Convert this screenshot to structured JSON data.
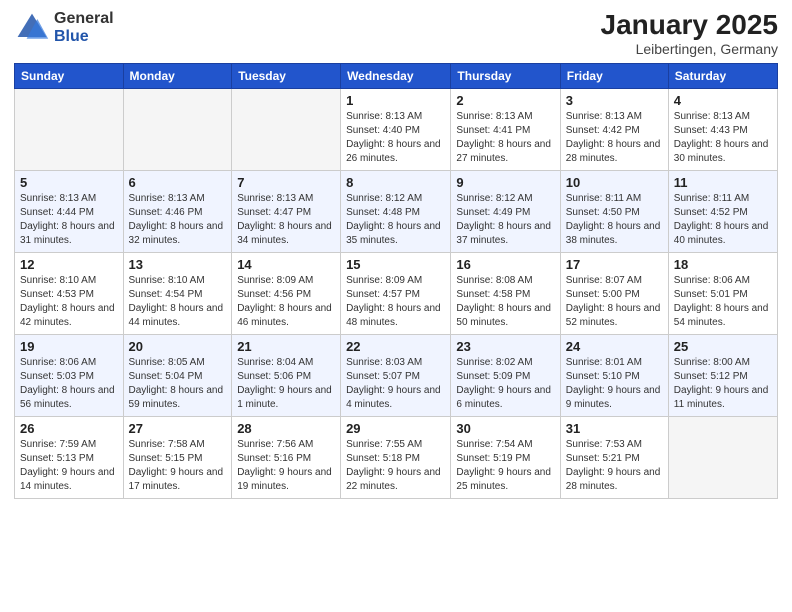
{
  "logo": {
    "general": "General",
    "blue": "Blue"
  },
  "header": {
    "month": "January 2025",
    "location": "Leibertingen, Germany"
  },
  "weekdays": [
    "Sunday",
    "Monday",
    "Tuesday",
    "Wednesday",
    "Thursday",
    "Friday",
    "Saturday"
  ],
  "weeks": [
    [
      {
        "day": "",
        "info": ""
      },
      {
        "day": "",
        "info": ""
      },
      {
        "day": "",
        "info": ""
      },
      {
        "day": "1",
        "info": "Sunrise: 8:13 AM\nSunset: 4:40 PM\nDaylight: 8 hours and 26 minutes."
      },
      {
        "day": "2",
        "info": "Sunrise: 8:13 AM\nSunset: 4:41 PM\nDaylight: 8 hours and 27 minutes."
      },
      {
        "day": "3",
        "info": "Sunrise: 8:13 AM\nSunset: 4:42 PM\nDaylight: 8 hours and 28 minutes."
      },
      {
        "day": "4",
        "info": "Sunrise: 8:13 AM\nSunset: 4:43 PM\nDaylight: 8 hours and 30 minutes."
      }
    ],
    [
      {
        "day": "5",
        "info": "Sunrise: 8:13 AM\nSunset: 4:44 PM\nDaylight: 8 hours and 31 minutes."
      },
      {
        "day": "6",
        "info": "Sunrise: 8:13 AM\nSunset: 4:46 PM\nDaylight: 8 hours and 32 minutes."
      },
      {
        "day": "7",
        "info": "Sunrise: 8:13 AM\nSunset: 4:47 PM\nDaylight: 8 hours and 34 minutes."
      },
      {
        "day": "8",
        "info": "Sunrise: 8:12 AM\nSunset: 4:48 PM\nDaylight: 8 hours and 35 minutes."
      },
      {
        "day": "9",
        "info": "Sunrise: 8:12 AM\nSunset: 4:49 PM\nDaylight: 8 hours and 37 minutes."
      },
      {
        "day": "10",
        "info": "Sunrise: 8:11 AM\nSunset: 4:50 PM\nDaylight: 8 hours and 38 minutes."
      },
      {
        "day": "11",
        "info": "Sunrise: 8:11 AM\nSunset: 4:52 PM\nDaylight: 8 hours and 40 minutes."
      }
    ],
    [
      {
        "day": "12",
        "info": "Sunrise: 8:10 AM\nSunset: 4:53 PM\nDaylight: 8 hours and 42 minutes."
      },
      {
        "day": "13",
        "info": "Sunrise: 8:10 AM\nSunset: 4:54 PM\nDaylight: 8 hours and 44 minutes."
      },
      {
        "day": "14",
        "info": "Sunrise: 8:09 AM\nSunset: 4:56 PM\nDaylight: 8 hours and 46 minutes."
      },
      {
        "day": "15",
        "info": "Sunrise: 8:09 AM\nSunset: 4:57 PM\nDaylight: 8 hours and 48 minutes."
      },
      {
        "day": "16",
        "info": "Sunrise: 8:08 AM\nSunset: 4:58 PM\nDaylight: 8 hours and 50 minutes."
      },
      {
        "day": "17",
        "info": "Sunrise: 8:07 AM\nSunset: 5:00 PM\nDaylight: 8 hours and 52 minutes."
      },
      {
        "day": "18",
        "info": "Sunrise: 8:06 AM\nSunset: 5:01 PM\nDaylight: 8 hours and 54 minutes."
      }
    ],
    [
      {
        "day": "19",
        "info": "Sunrise: 8:06 AM\nSunset: 5:03 PM\nDaylight: 8 hours and 56 minutes."
      },
      {
        "day": "20",
        "info": "Sunrise: 8:05 AM\nSunset: 5:04 PM\nDaylight: 8 hours and 59 minutes."
      },
      {
        "day": "21",
        "info": "Sunrise: 8:04 AM\nSunset: 5:06 PM\nDaylight: 9 hours and 1 minute."
      },
      {
        "day": "22",
        "info": "Sunrise: 8:03 AM\nSunset: 5:07 PM\nDaylight: 9 hours and 4 minutes."
      },
      {
        "day": "23",
        "info": "Sunrise: 8:02 AM\nSunset: 5:09 PM\nDaylight: 9 hours and 6 minutes."
      },
      {
        "day": "24",
        "info": "Sunrise: 8:01 AM\nSunset: 5:10 PM\nDaylight: 9 hours and 9 minutes."
      },
      {
        "day": "25",
        "info": "Sunrise: 8:00 AM\nSunset: 5:12 PM\nDaylight: 9 hours and 11 minutes."
      }
    ],
    [
      {
        "day": "26",
        "info": "Sunrise: 7:59 AM\nSunset: 5:13 PM\nDaylight: 9 hours and 14 minutes."
      },
      {
        "day": "27",
        "info": "Sunrise: 7:58 AM\nSunset: 5:15 PM\nDaylight: 9 hours and 17 minutes."
      },
      {
        "day": "28",
        "info": "Sunrise: 7:56 AM\nSunset: 5:16 PM\nDaylight: 9 hours and 19 minutes."
      },
      {
        "day": "29",
        "info": "Sunrise: 7:55 AM\nSunset: 5:18 PM\nDaylight: 9 hours and 22 minutes."
      },
      {
        "day": "30",
        "info": "Sunrise: 7:54 AM\nSunset: 5:19 PM\nDaylight: 9 hours and 25 minutes."
      },
      {
        "day": "31",
        "info": "Sunrise: 7:53 AM\nSunset: 5:21 PM\nDaylight: 9 hours and 28 minutes."
      },
      {
        "day": "",
        "info": ""
      }
    ]
  ]
}
